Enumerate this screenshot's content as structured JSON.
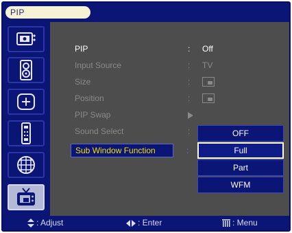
{
  "title": "PIP",
  "sidebar": {
    "items": [
      {
        "icon": "picture-icon"
      },
      {
        "icon": "speaker-icon"
      },
      {
        "icon": "setup-icon"
      },
      {
        "icon": "remote-input-icon"
      },
      {
        "icon": "multimedia-icon"
      },
      {
        "icon": "pip-tv-icon",
        "active": true
      }
    ]
  },
  "menu": {
    "rows": [
      {
        "label": "PIP",
        "colon": ":",
        "value": "Off",
        "enabled": true
      },
      {
        "label": "Input Source",
        "colon": ":",
        "value": "TV",
        "enabled": false
      },
      {
        "label": "Size",
        "colon": ":",
        "value_icon": "size-box-icon",
        "enabled": false
      },
      {
        "label": "Position",
        "colon": ":",
        "value_icon": "position-box-icon",
        "enabled": false
      },
      {
        "label": "PIP Swap",
        "value_icon": "arrow-right-icon",
        "enabled": false
      },
      {
        "label": "Sound Select",
        "colon": ":",
        "enabled": false
      }
    ],
    "selected": {
      "label": "Sub Window Function",
      "colon": ":"
    }
  },
  "dropdown": {
    "options": [
      "OFF",
      "Full",
      "Part",
      "WFM"
    ],
    "selected": "Full"
  },
  "bottom": {
    "adjust": ": Adjust",
    "enter": ": Enter",
    "menu": ": Menu"
  },
  "colors": {
    "navy": "#0b1575",
    "panel_gray": "#4d4d4d",
    "highlight_text": "#f4e200",
    "disabled_text": "#8a8a8a"
  }
}
